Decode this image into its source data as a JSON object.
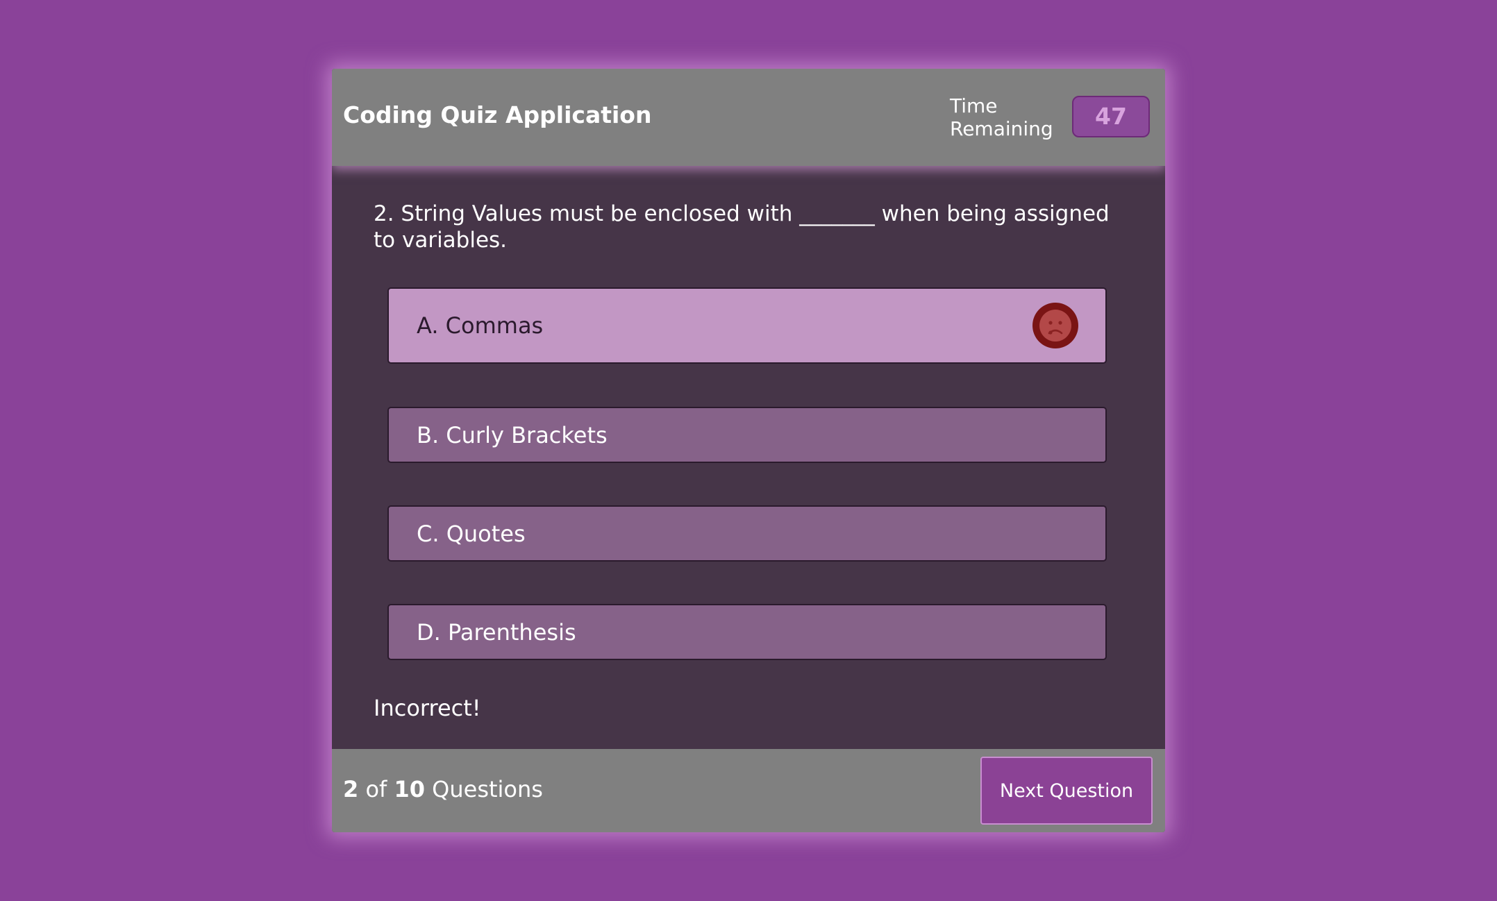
{
  "header": {
    "title": "Coding Quiz Application",
    "time_label": "Time Remaining",
    "time_value": "47"
  },
  "question": {
    "text": "2. String Values must be enclosed with _______ when being assigned to variables."
  },
  "answers": [
    {
      "label": "A. Commas",
      "state": "selected-incorrect",
      "icon": "sad-face-icon"
    },
    {
      "label": "B. Curly Brackets"
    },
    {
      "label": "C. Quotes"
    },
    {
      "label": "D. Parenthesis"
    }
  ],
  "feedback": {
    "text": "Incorrect!"
  },
  "footer": {
    "current": "2",
    "of_text": "of",
    "total": "10",
    "questions_text": "Questions",
    "next_label": "Next Question"
  },
  "colors": {
    "page_background": "#8a4299",
    "card_background": "#463548",
    "header_background": "#808080",
    "selected_answer": "#c297c4",
    "answer_background": "#866289",
    "incorrect_icon": "#7a1414"
  }
}
